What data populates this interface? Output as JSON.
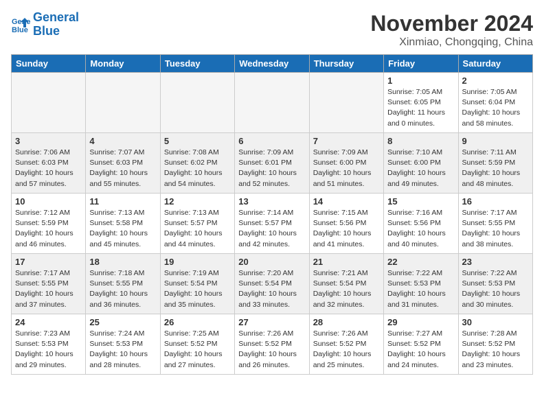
{
  "header": {
    "logo_line1": "General",
    "logo_line2": "Blue",
    "month_year": "November 2024",
    "location": "Xinmiao, Chongqing, China"
  },
  "weekdays": [
    "Sunday",
    "Monday",
    "Tuesday",
    "Wednesday",
    "Thursday",
    "Friday",
    "Saturday"
  ],
  "weeks": [
    [
      {
        "day": "",
        "info": ""
      },
      {
        "day": "",
        "info": ""
      },
      {
        "day": "",
        "info": ""
      },
      {
        "day": "",
        "info": ""
      },
      {
        "day": "",
        "info": ""
      },
      {
        "day": "1",
        "info": "Sunrise: 7:05 AM\nSunset: 6:05 PM\nDaylight: 11 hours\nand 0 minutes."
      },
      {
        "day": "2",
        "info": "Sunrise: 7:05 AM\nSunset: 6:04 PM\nDaylight: 10 hours\nand 58 minutes."
      }
    ],
    [
      {
        "day": "3",
        "info": "Sunrise: 7:06 AM\nSunset: 6:03 PM\nDaylight: 10 hours\nand 57 minutes."
      },
      {
        "day": "4",
        "info": "Sunrise: 7:07 AM\nSunset: 6:03 PM\nDaylight: 10 hours\nand 55 minutes."
      },
      {
        "day": "5",
        "info": "Sunrise: 7:08 AM\nSunset: 6:02 PM\nDaylight: 10 hours\nand 54 minutes."
      },
      {
        "day": "6",
        "info": "Sunrise: 7:09 AM\nSunset: 6:01 PM\nDaylight: 10 hours\nand 52 minutes."
      },
      {
        "day": "7",
        "info": "Sunrise: 7:09 AM\nSunset: 6:00 PM\nDaylight: 10 hours\nand 51 minutes."
      },
      {
        "day": "8",
        "info": "Sunrise: 7:10 AM\nSunset: 6:00 PM\nDaylight: 10 hours\nand 49 minutes."
      },
      {
        "day": "9",
        "info": "Sunrise: 7:11 AM\nSunset: 5:59 PM\nDaylight: 10 hours\nand 48 minutes."
      }
    ],
    [
      {
        "day": "10",
        "info": "Sunrise: 7:12 AM\nSunset: 5:59 PM\nDaylight: 10 hours\nand 46 minutes."
      },
      {
        "day": "11",
        "info": "Sunrise: 7:13 AM\nSunset: 5:58 PM\nDaylight: 10 hours\nand 45 minutes."
      },
      {
        "day": "12",
        "info": "Sunrise: 7:13 AM\nSunset: 5:57 PM\nDaylight: 10 hours\nand 44 minutes."
      },
      {
        "day": "13",
        "info": "Sunrise: 7:14 AM\nSunset: 5:57 PM\nDaylight: 10 hours\nand 42 minutes."
      },
      {
        "day": "14",
        "info": "Sunrise: 7:15 AM\nSunset: 5:56 PM\nDaylight: 10 hours\nand 41 minutes."
      },
      {
        "day": "15",
        "info": "Sunrise: 7:16 AM\nSunset: 5:56 PM\nDaylight: 10 hours\nand 40 minutes."
      },
      {
        "day": "16",
        "info": "Sunrise: 7:17 AM\nSunset: 5:55 PM\nDaylight: 10 hours\nand 38 minutes."
      }
    ],
    [
      {
        "day": "17",
        "info": "Sunrise: 7:17 AM\nSunset: 5:55 PM\nDaylight: 10 hours\nand 37 minutes."
      },
      {
        "day": "18",
        "info": "Sunrise: 7:18 AM\nSunset: 5:55 PM\nDaylight: 10 hours\nand 36 minutes."
      },
      {
        "day": "19",
        "info": "Sunrise: 7:19 AM\nSunset: 5:54 PM\nDaylight: 10 hours\nand 35 minutes."
      },
      {
        "day": "20",
        "info": "Sunrise: 7:20 AM\nSunset: 5:54 PM\nDaylight: 10 hours\nand 33 minutes."
      },
      {
        "day": "21",
        "info": "Sunrise: 7:21 AM\nSunset: 5:54 PM\nDaylight: 10 hours\nand 32 minutes."
      },
      {
        "day": "22",
        "info": "Sunrise: 7:22 AM\nSunset: 5:53 PM\nDaylight: 10 hours\nand 31 minutes."
      },
      {
        "day": "23",
        "info": "Sunrise: 7:22 AM\nSunset: 5:53 PM\nDaylight: 10 hours\nand 30 minutes."
      }
    ],
    [
      {
        "day": "24",
        "info": "Sunrise: 7:23 AM\nSunset: 5:53 PM\nDaylight: 10 hours\nand 29 minutes."
      },
      {
        "day": "25",
        "info": "Sunrise: 7:24 AM\nSunset: 5:53 PM\nDaylight: 10 hours\nand 28 minutes."
      },
      {
        "day": "26",
        "info": "Sunrise: 7:25 AM\nSunset: 5:52 PM\nDaylight: 10 hours\nand 27 minutes."
      },
      {
        "day": "27",
        "info": "Sunrise: 7:26 AM\nSunset: 5:52 PM\nDaylight: 10 hours\nand 26 minutes."
      },
      {
        "day": "28",
        "info": "Sunrise: 7:26 AM\nSunset: 5:52 PM\nDaylight: 10 hours\nand 25 minutes."
      },
      {
        "day": "29",
        "info": "Sunrise: 7:27 AM\nSunset: 5:52 PM\nDaylight: 10 hours\nand 24 minutes."
      },
      {
        "day": "30",
        "info": "Sunrise: 7:28 AM\nSunset: 5:52 PM\nDaylight: 10 hours\nand 23 minutes."
      }
    ]
  ]
}
